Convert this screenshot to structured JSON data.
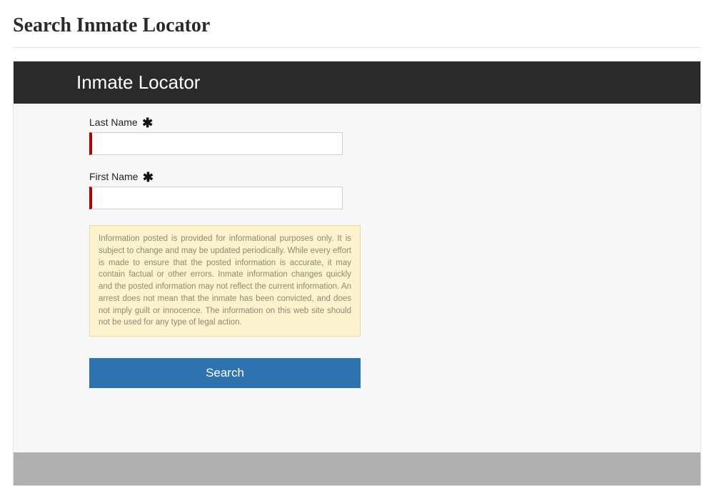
{
  "page": {
    "title": "Search Inmate Locator"
  },
  "app": {
    "header_title": "Inmate Locator"
  },
  "form": {
    "last_name": {
      "label": "Last Name",
      "value": "",
      "required_mark": "✱"
    },
    "first_name": {
      "label": "First Name",
      "value": "",
      "required_mark": "✱"
    },
    "disclaimer_text": "Information posted is provided for informational purposes only. It is subject to change and may be updated periodically. While every effort is made to ensure that the posted information is accurate, it may contain factual or other errors. Inmate information changes quickly and the posted information may not reflect the current information. An arrest does not mean that the inmate has been convicted, and does not imply guilt or innocence. The information on this web site should not be used for any type of legal action.",
    "search_label": "Search"
  }
}
